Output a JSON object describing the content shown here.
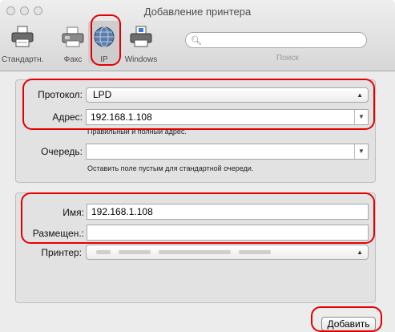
{
  "window": {
    "title": "Добавление принтера"
  },
  "toolbar": {
    "items": [
      {
        "label": "Стандартн.",
        "icon": "default-printer-icon"
      },
      {
        "label": "Факс",
        "icon": "fax-icon"
      },
      {
        "label": "IP",
        "icon": "globe-icon",
        "selected": true
      },
      {
        "label": "Windows",
        "icon": "windows-printer-icon"
      }
    ],
    "search": {
      "placeholder": "",
      "label": "Поиск"
    }
  },
  "form": {
    "protocol": {
      "label": "Протокол:",
      "value": "LPD"
    },
    "address": {
      "label": "Адрес:",
      "value": "192.168.1.108",
      "hint": "Правильный и полный адрес."
    },
    "queue": {
      "label": "Очередь:",
      "value": "",
      "hint": "Оставить поле пустым для стандартной очереди."
    },
    "name": {
      "label": "Имя:",
      "value": "192.168.1.108"
    },
    "location": {
      "label": "Размещен.:",
      "value": ""
    },
    "printer": {
      "label": "Принтер:",
      "value": ""
    }
  },
  "actions": {
    "add_label": "Добавить"
  },
  "colors": {
    "highlight": "#e50000"
  }
}
